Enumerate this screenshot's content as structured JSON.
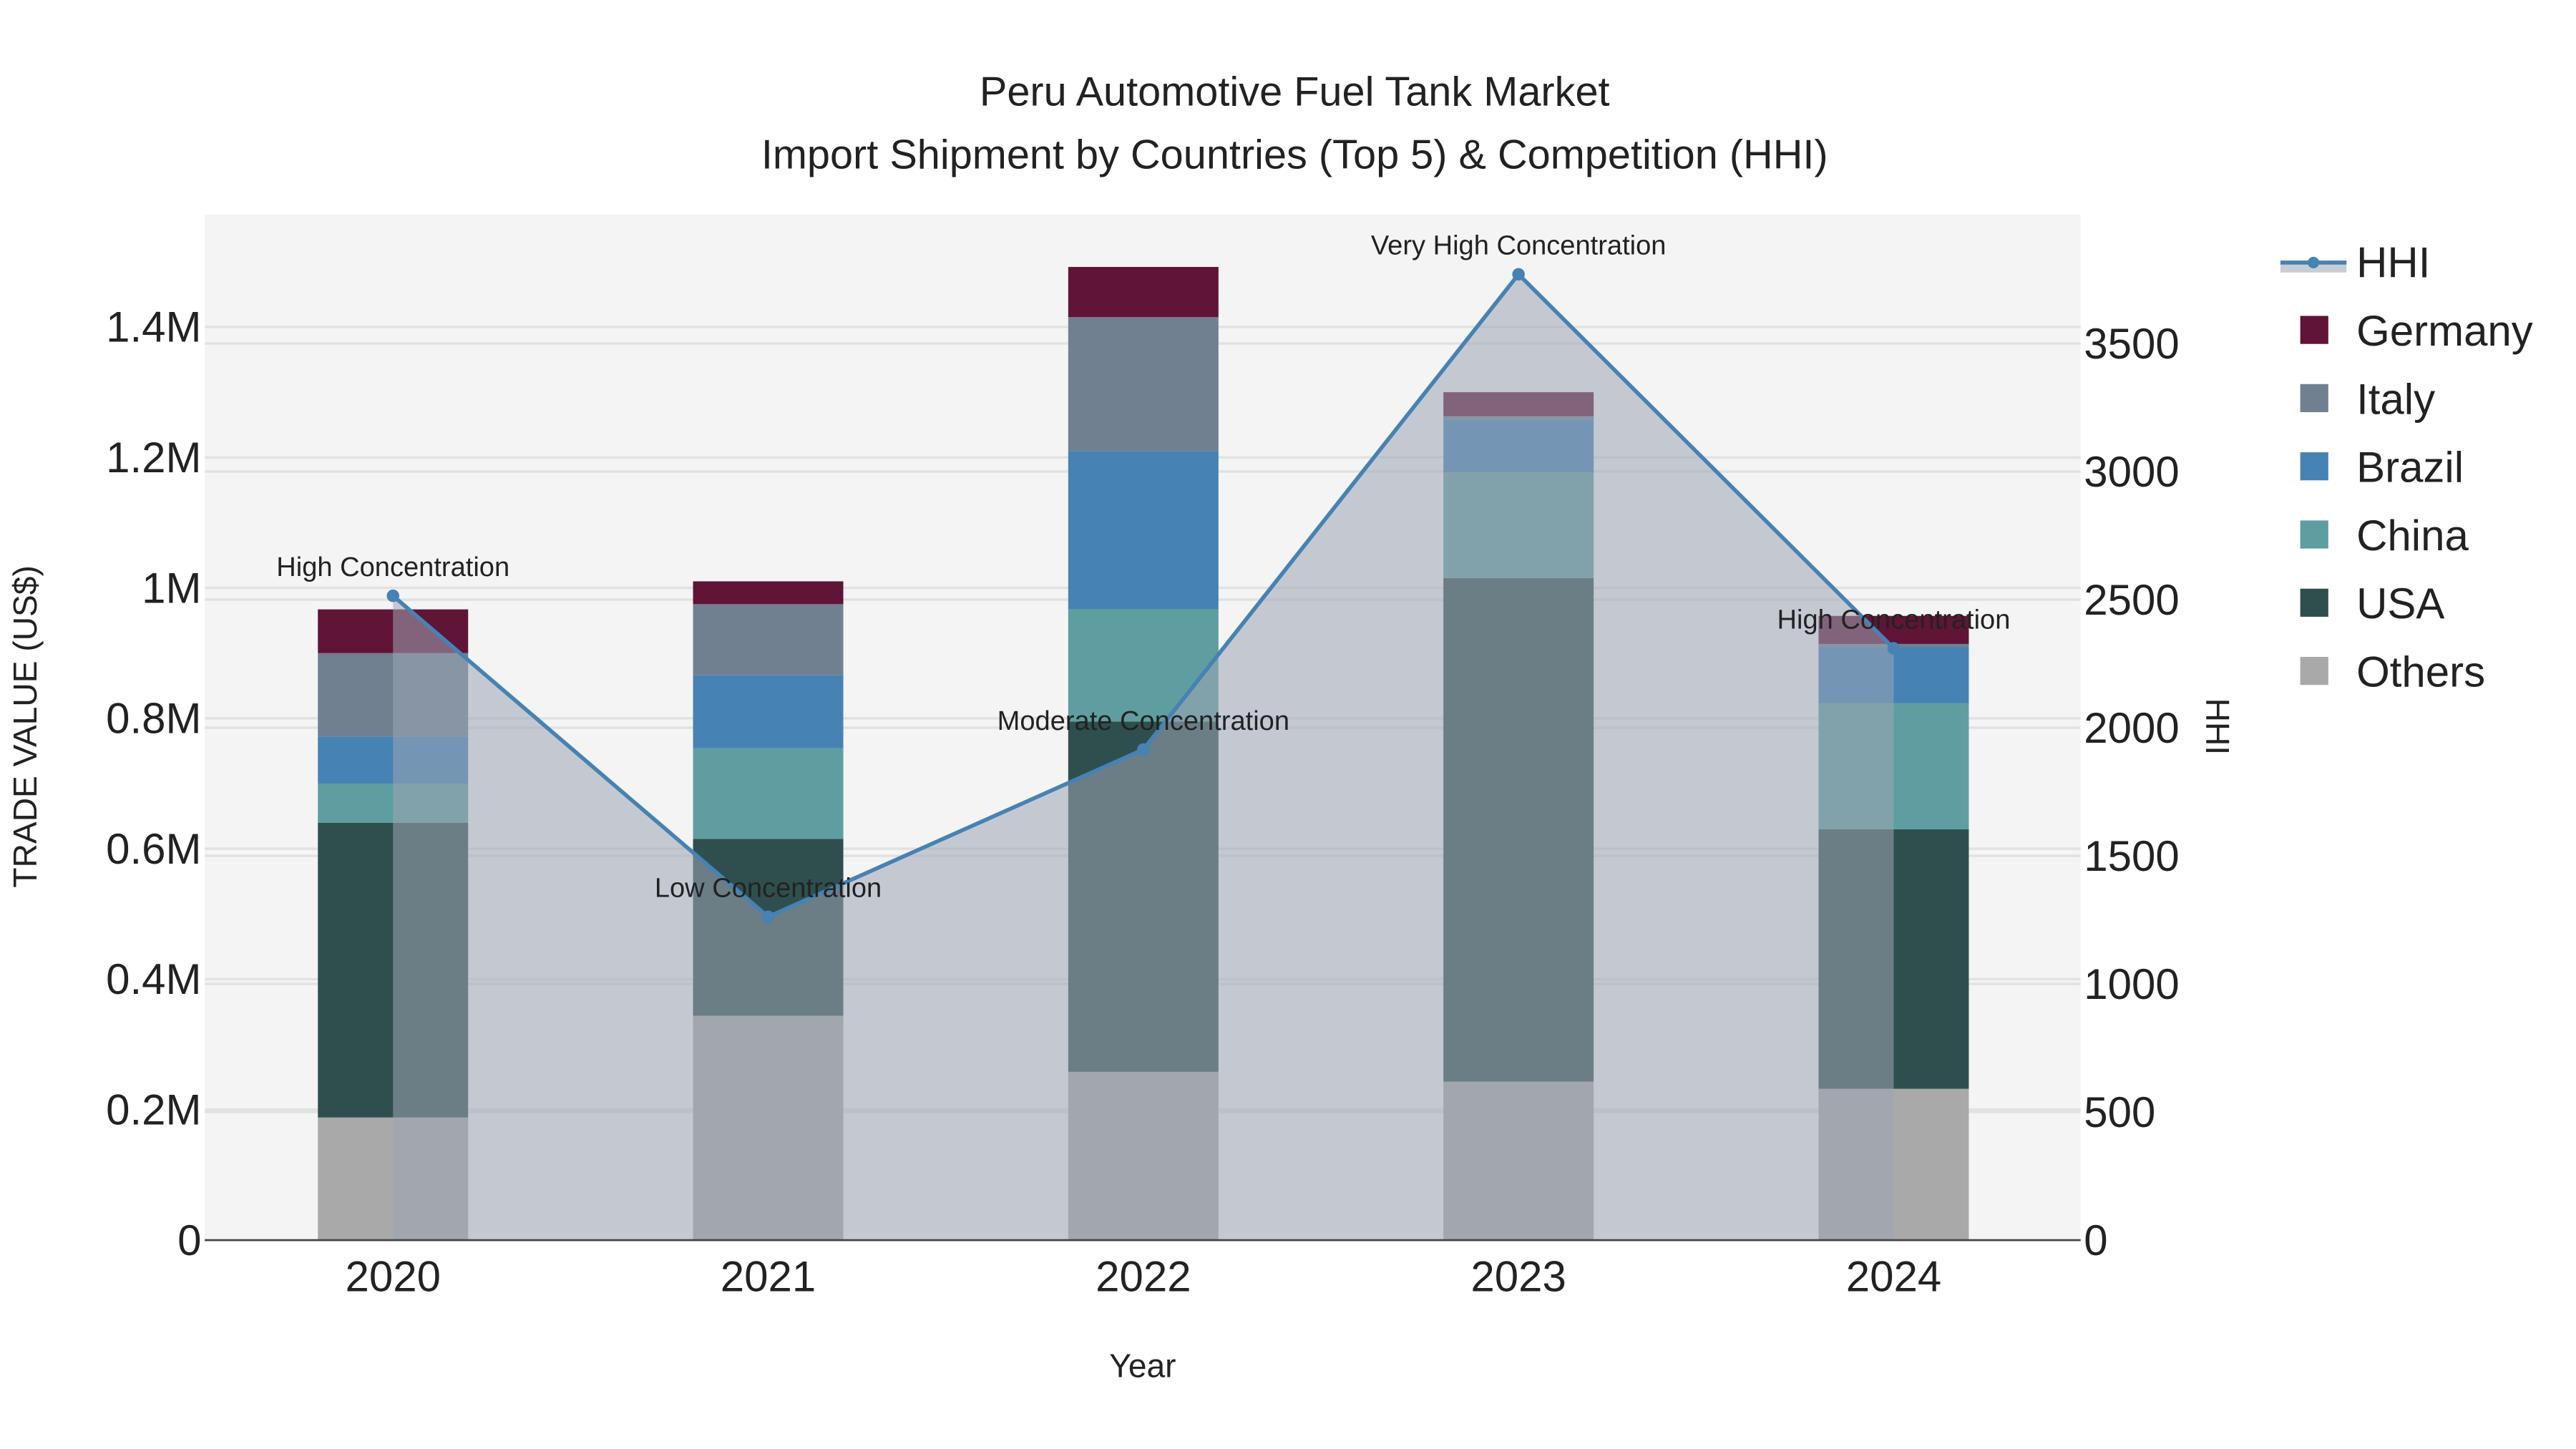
{
  "chart_data": {
    "type": "bar",
    "title_line1": "Peru Automotive Fuel Tank Market",
    "title_line2": "Import Shipment by Countries (Top 5) & Competition (HHI)",
    "xlabel": "Year",
    "ylabel": "TRADE VALUE (US$)",
    "y2label": "HHI",
    "categories": [
      "2020",
      "2021",
      "2022",
      "2023",
      "2024"
    ],
    "ylim": [
      0,
      1570000
    ],
    "y2lim": [
      0,
      4000
    ],
    "yticks": [
      0,
      200000,
      400000,
      600000,
      800000,
      1000000,
      1200000,
      1400000
    ],
    "ytick_labels": [
      "0",
      "0.2M",
      "0.4M",
      "0.6M",
      "0.8M",
      "1M",
      "1.2M",
      "1.4M"
    ],
    "y2ticks": [
      0,
      500,
      1000,
      1500,
      2000,
      2500,
      3000,
      3500
    ],
    "y2tick_labels": [
      "0",
      "500",
      "1000",
      "1500",
      "2000",
      "2500",
      "3000",
      "3500"
    ],
    "series": [
      {
        "name": "Others",
        "color": "#a9a9a9",
        "values": [
          188000,
          344000,
          258000,
          243000,
          232000
        ]
      },
      {
        "name": "USA",
        "color": "#2f4f4f",
        "values": [
          452000,
          271000,
          537000,
          772000,
          398000
        ]
      },
      {
        "name": "China",
        "color": "#5f9ea0",
        "values": [
          60000,
          139000,
          172000,
          162000,
          193000
        ]
      },
      {
        "name": "Brazil",
        "color": "#4682b4",
        "values": [
          72000,
          112000,
          243000,
          81000,
          86000
        ]
      },
      {
        "name": "Italy",
        "color": "#708090",
        "values": [
          128000,
          109000,
          205000,
          5000,
          5000
        ]
      },
      {
        "name": "Germany",
        "color": "#601436",
        "values": [
          67000,
          35000,
          77000,
          37000,
          43000
        ]
      }
    ],
    "hhi": {
      "name": "HHI",
      "color": "#4682b4",
      "values": [
        2515,
        1262,
        1915,
        3770,
        2310
      ],
      "annotations": [
        "High Concentration",
        "Low Concentration",
        "Moderate Concentration",
        "Very High Concentration",
        "High Concentration"
      ]
    },
    "legend_order": [
      "HHI",
      "Germany",
      "Italy",
      "Brazil",
      "China",
      "USA",
      "Others"
    ],
    "legend_placement": "right",
    "grid": true
  }
}
